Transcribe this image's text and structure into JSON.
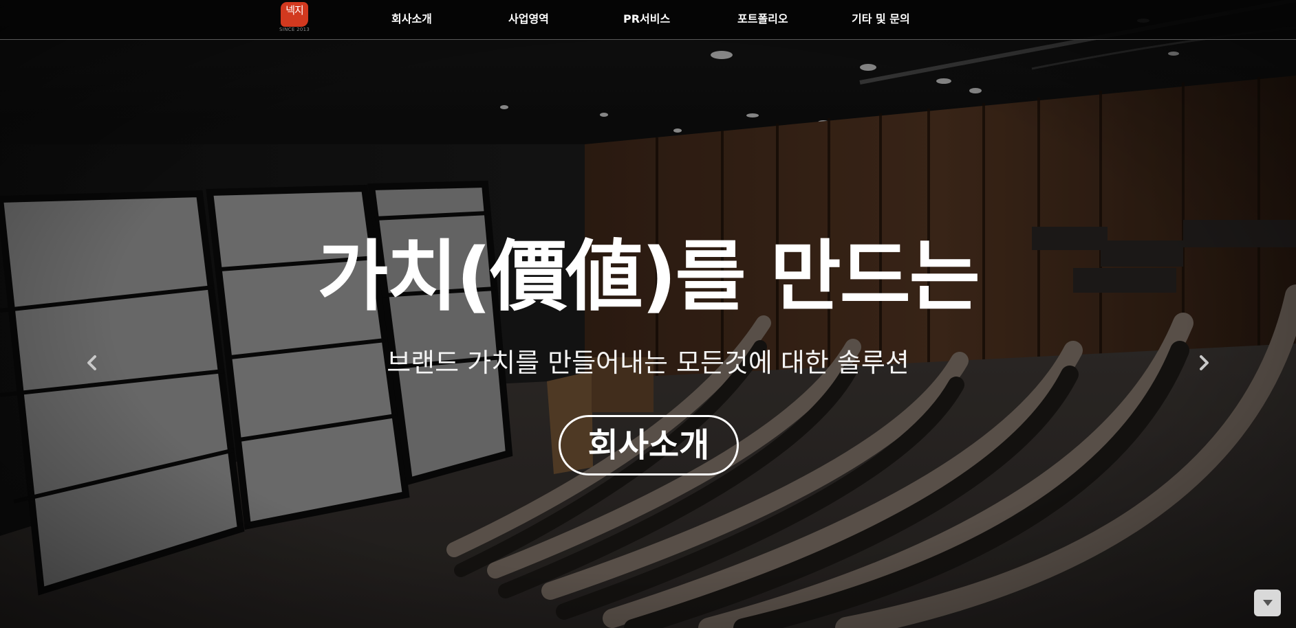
{
  "header": {
    "logo": {
      "mark_text": "넥지",
      "since_text": "SINCE 2013",
      "color": "#d2391f"
    },
    "nav": [
      {
        "label": "회사소개"
      },
      {
        "label": "사업영역"
      },
      {
        "label": "PR서비스"
      },
      {
        "label": "포트폴리오"
      },
      {
        "label": "기타 및 문의"
      }
    ]
  },
  "hero": {
    "title": "가치(價値)를 만드는",
    "subtitle": "브랜드 가치를 만들어내는 모든것에 대한 솔루션",
    "button_label": "회사소개"
  },
  "carousel": {
    "prev_icon": "chevron-left-icon",
    "next_icon": "chevron-right-icon"
  },
  "scroll_button": {
    "icon": "caret-down-icon"
  },
  "colors": {
    "header_bg": "#050505",
    "text": "#ffffff",
    "accent": "#d2391f",
    "scroll_btn_bg": "#d9d9d9"
  }
}
